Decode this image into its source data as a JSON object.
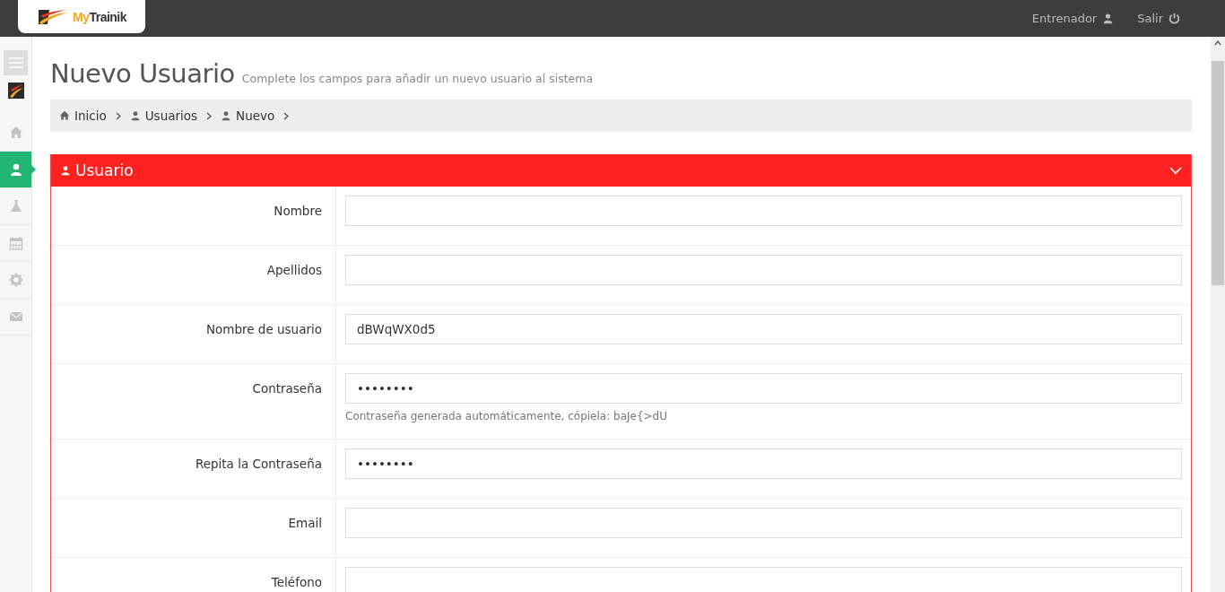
{
  "header": {
    "brand_prefix": "My",
    "brand_name": "Trainik",
    "user_link": "Entrenador",
    "logout_link": "Salir"
  },
  "sidebar": {
    "items": [
      {
        "kind": "home",
        "selected": false
      },
      {
        "kind": "user",
        "selected": true
      },
      {
        "kind": "flask",
        "selected": false
      },
      {
        "kind": "calendar",
        "selected": false
      },
      {
        "kind": "gear",
        "selected": false
      },
      {
        "kind": "mail",
        "selected": false
      }
    ]
  },
  "page": {
    "title": "Nuevo Usuario",
    "subtitle": "Complete los campos para añadir un nuevo usuario al sistema"
  },
  "breadcrumb": [
    {
      "kind": "home",
      "label": "Inicio"
    },
    {
      "kind": "user",
      "label": "Usuarios"
    },
    {
      "kind": "user",
      "label": "Nuevo"
    }
  ],
  "panel": {
    "title": "Usuario",
    "expanded": true,
    "fields": [
      {
        "label": "Nombre"
      },
      {
        "label": "Apellidos"
      },
      {
        "label": "Nombre de usuario",
        "value": "dBWqWX0d5"
      },
      {
        "label": "Contraseña",
        "value": "••••••••",
        "help": "Contraseña generada automáticamente, cópiela: baJe{>dU"
      },
      {
        "label": "Repita la Contraseña",
        "value": "••••••••"
      },
      {
        "label": "Email"
      },
      {
        "label": "Teléfono"
      }
    ]
  }
}
